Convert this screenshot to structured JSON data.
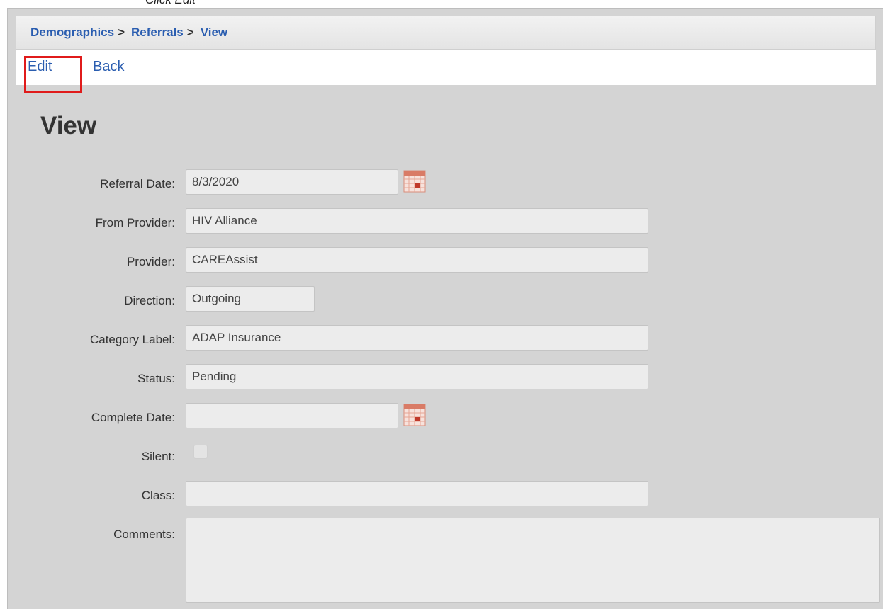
{
  "caption": "Click Edit",
  "breadcrumb": {
    "items": [
      "Demographics",
      "Referrals",
      "View"
    ],
    "separator": ">"
  },
  "actions": {
    "edit_label": "Edit",
    "back_label": "Back"
  },
  "page": {
    "title": "View"
  },
  "form": {
    "referral_date": {
      "label": "Referral Date:",
      "value": "8/3/2020"
    },
    "from_provider": {
      "label": "From Provider:",
      "value": "HIV Alliance"
    },
    "provider": {
      "label": "Provider:",
      "value": "CAREAssist"
    },
    "direction": {
      "label": "Direction:",
      "value": "Outgoing"
    },
    "category_label": {
      "label": "Category Label:",
      "value": "ADAP Insurance"
    },
    "status": {
      "label": "Status:",
      "value": "Pending"
    },
    "complete_date": {
      "label": "Complete Date:",
      "value": ""
    },
    "silent": {
      "label": "Silent:",
      "checked": false
    },
    "class": {
      "label": "Class:",
      "value": ""
    },
    "comments": {
      "label": "Comments:",
      "value": ""
    }
  },
  "icons": {
    "calendar": "calendar-icon"
  },
  "colors": {
    "link": "#2a5db0",
    "highlight": "#e01b1b",
    "panel_bg": "#d4d4d4",
    "field_bg": "#ececec"
  }
}
